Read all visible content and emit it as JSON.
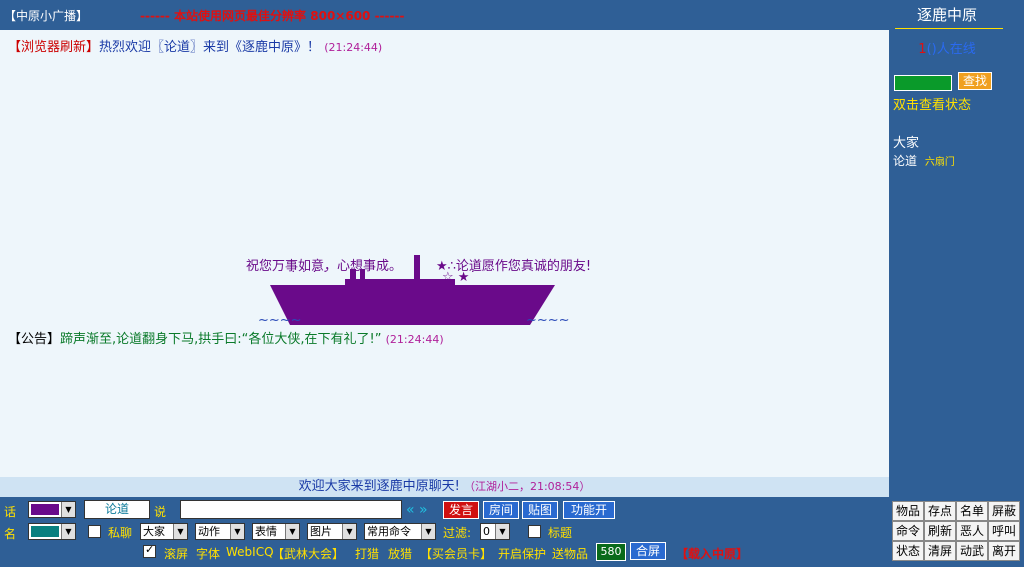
{
  "topbar": {
    "broadcast_label": "【中原小广播】",
    "marquee_text": "------ 本站使用网页最佳分辨率 800×600 ------"
  },
  "chat": {
    "msg1": {
      "prefix": "【浏览器刷新】",
      "text_a": "热烈欢迎",
      "user": "〖论道〗",
      "text_b": "来到《逐鹿中原》！",
      "time": "(21:24:44)"
    },
    "art": {
      "greeting": "祝您万事如意，心想事成。",
      "stars1": "★∴论道愿作您真诚的朋友!",
      "stars2": "☆ ★˙",
      "dots": "˙ ˙ ˙ ˙",
      "waves_left": "~~~~",
      "waves_right": "~~~~"
    },
    "msg2": {
      "prefix": "【公告】",
      "text": "蹄声渐至,论道翻身下马,拱手曰:“各位大侠,在下有礼了!”",
      "time": "(21:24:44)"
    }
  },
  "welcome_bar": {
    "text": "欢迎大家来到逐鹿中原聊天!",
    "meta": "（江湖小二，21:08:54）"
  },
  "right_panel": {
    "room_name": "逐鹿中原",
    "online_count": "1",
    "online_text": "()人在线",
    "search_button": "查找",
    "status_link": "双击查看状态",
    "everyone": "大家",
    "user_name": "论道",
    "user_sect": "六扇门"
  },
  "controls": {
    "talk_label": "话",
    "name_label": "名",
    "speaker": "论道",
    "say_label": "说",
    "send": "发言",
    "room": "房间",
    "paste_image": "贴图",
    "function_toggle": "功能开",
    "whisper": "私聊",
    "target_select": "大家",
    "action_select": "动作",
    "emote_select": "表情",
    "image_select": "图片",
    "command_select": "常用命令",
    "filter_label": "过滤:",
    "filter_value": "0",
    "title_label": "标题",
    "scroll_label": "滚屏",
    "font_label": "字体",
    "webicq_label": "WebICQ",
    "martial_meet": "【武林大会】",
    "fight": "打猎",
    "release": "放猎",
    "buy_card": "【买会员卡】",
    "protect": "开启保护",
    "gift": "送物品",
    "counter": "580",
    "merge_screen": "合屏",
    "enter_text": "【载入中原】"
  },
  "colors": {
    "talk_color": "#6a0a8a",
    "name_color": "#0a8080",
    "ship": "#6a0a8a"
  },
  "side_buttons": [
    "物品",
    "存点",
    "名单",
    "屏蔽",
    "命令",
    "刷新",
    "恶人",
    "呼叫",
    "状态",
    "清屏",
    "动武",
    "离开"
  ]
}
